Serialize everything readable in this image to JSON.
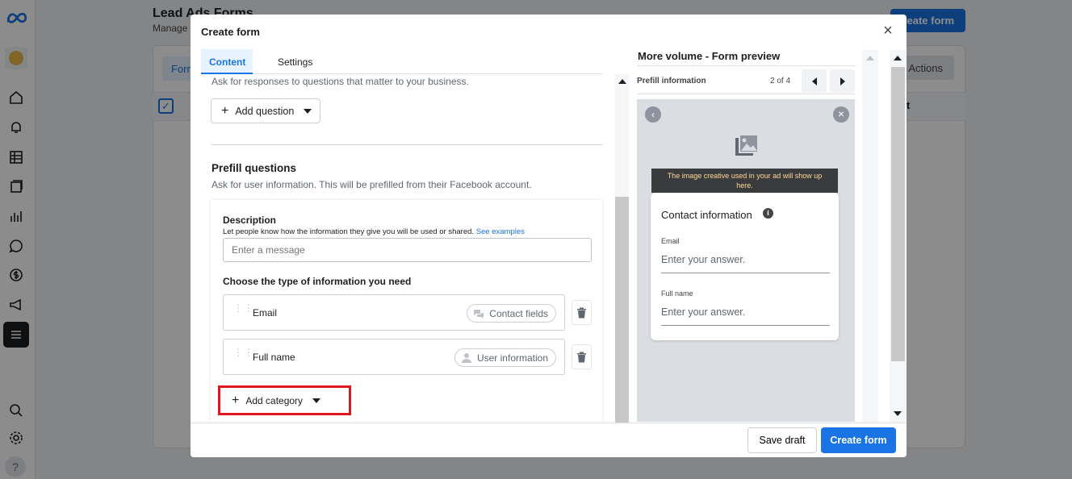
{
  "background": {
    "title": "Lead Ads Forms",
    "subtitle": "Manage",
    "create_button": "Create form",
    "forms_tab": "Form",
    "actions_button": "Actions",
    "column_fragment": "t"
  },
  "modal": {
    "title": "Create form",
    "tabs": [
      {
        "label": "Content"
      },
      {
        "label": "Settings"
      }
    ],
    "ask_text": "Ask for responses to questions that matter to your business.",
    "add_question_label": "Add question",
    "prefill_heading": "Prefill questions",
    "prefill_subtext": "Ask for user information. This will be prefilled from their Facebook account.",
    "description_heading": "Description",
    "description_subtext": "Let people know how the information they give you will be used or shared.",
    "description_link": "See examples",
    "message_placeholder": "Enter a message",
    "choose_heading": "Choose the type of information you need",
    "fields": [
      {
        "name": "Email",
        "category": "Contact fields"
      },
      {
        "name": "Full name",
        "category": "User information"
      }
    ],
    "add_category_label": "Add category",
    "save_draft_label": "Save draft",
    "create_form_label": "Create form"
  },
  "preview": {
    "title": "More volume - Form preview",
    "section_label": "Prefill information",
    "page_indicator": "2 of 4",
    "banner_text": "The image creative used in your ad will show up here.",
    "card_title": "Contact information",
    "fields": [
      {
        "label": "Email",
        "placeholder": "Enter your answer."
      },
      {
        "label": "Full name",
        "placeholder": "Enter your answer."
      }
    ]
  }
}
